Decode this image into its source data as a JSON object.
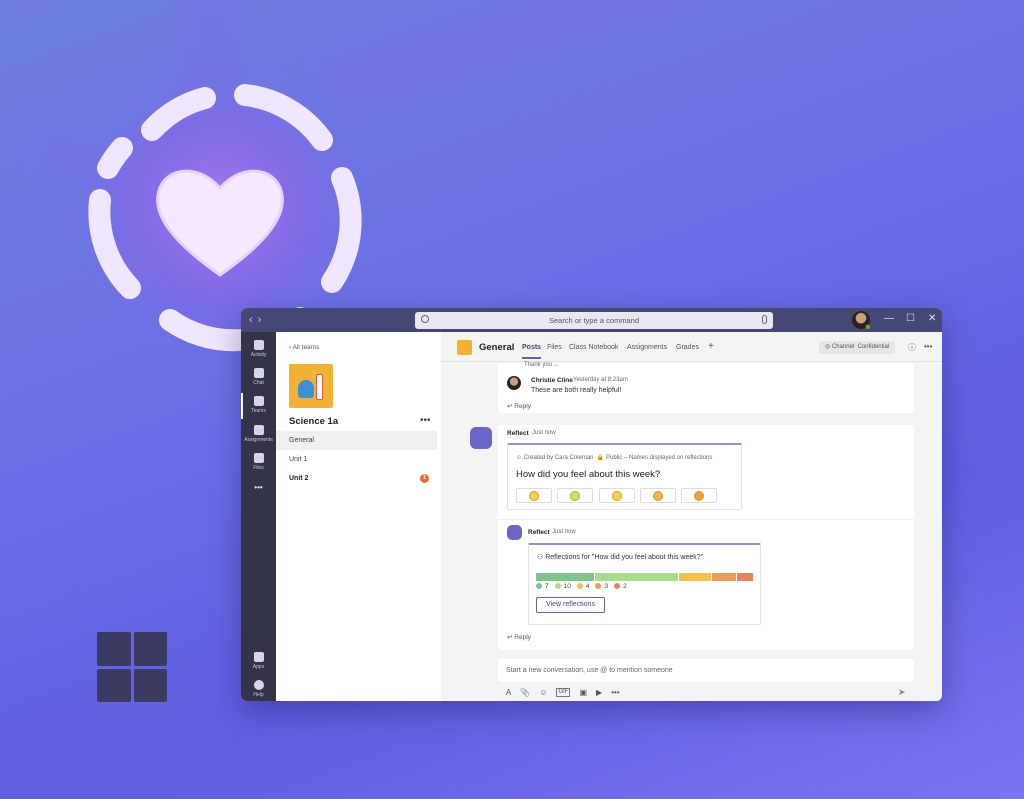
{
  "titlebar": {
    "search_placeholder": "Search or type a command",
    "back_arrow": "‹",
    "forward_arrow": "›",
    "minimize": "—",
    "maximize": "☐",
    "close": "✕"
  },
  "rail": {
    "items": [
      {
        "label": "Activity",
        "icon": "bell-icon"
      },
      {
        "label": "Chat",
        "icon": "chat-icon"
      },
      {
        "label": "Teams",
        "icon": "teams-icon"
      },
      {
        "label": "Assignments",
        "icon": "assignments-icon"
      },
      {
        "label": "Files",
        "icon": "files-icon"
      },
      {
        "label": "•••",
        "icon": "more-icon"
      },
      {
        "label": "Apps",
        "icon": "apps-icon"
      },
      {
        "label": "Help",
        "icon": "help-icon"
      }
    ]
  },
  "teampanel": {
    "all_teams": "‹ All teams",
    "team_name": "Science 1a",
    "more": "•••",
    "channels": [
      {
        "name": "General"
      },
      {
        "name": "Unit 1"
      },
      {
        "name": "Unit 2",
        "badge": "1"
      }
    ]
  },
  "header": {
    "channel_name": "General",
    "tabs": [
      "Posts",
      "Files",
      "Class Notebook",
      "Assignments",
      "Grades"
    ],
    "add_tab": "+",
    "channel_pill": "Channel",
    "confidential_pill": "Confidential",
    "info": "ⓘ",
    "more": "•••"
  },
  "thread1": {
    "prev_text": "Thank you ...",
    "author": "Christie Cline",
    "time": "Yesterday at 8:23am",
    "message": "These are both really helpful!",
    "reply": "Reply"
  },
  "reflect_post": {
    "author": "Reflect",
    "time": "Just now",
    "created_by": "Created by Cara Coleman",
    "visibility": "Public – Names displayed on reflections",
    "question": "How did you feel about this week?"
  },
  "reflect_reply": {
    "author": "Reflect",
    "time": "Just now",
    "reflections_title": "Reflections for \"How did you feel about this week?\"",
    "legend": [
      {
        "value": "7",
        "color": "#7fc48a"
      },
      {
        "value": "10",
        "color": "#a8dc8c"
      },
      {
        "value": "4",
        "color": "#f2c14e"
      },
      {
        "value": "3",
        "color": "#ee9a5a"
      },
      {
        "value": "2",
        "color": "#e8825e"
      }
    ],
    "view_button": "View reflections",
    "reply": "Reply"
  },
  "compose": {
    "placeholder": "Start a new conversation, use @ to mention someone",
    "tools": [
      "A",
      "📎",
      "☺",
      "GIF",
      "▣",
      "▶",
      "•••"
    ],
    "send": "➤"
  },
  "colors": {
    "accent": "#6264a7",
    "titlebar": "#464775",
    "rail": "#33344a"
  }
}
